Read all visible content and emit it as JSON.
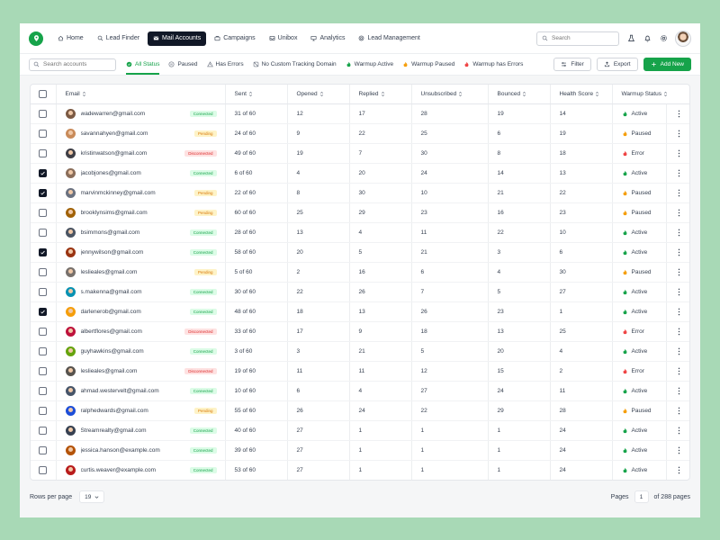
{
  "nav": {
    "items": [
      {
        "label": "Home",
        "icon": "home-icon"
      },
      {
        "label": "Lead Finder",
        "icon": "search-icon"
      },
      {
        "label": "Mail Accounts",
        "icon": "mail-icon",
        "active": true
      },
      {
        "label": "Campaigns",
        "icon": "briefcase-icon"
      },
      {
        "label": "Unibox",
        "icon": "inbox-icon"
      },
      {
        "label": "Analytics",
        "icon": "monitor-icon"
      },
      {
        "label": "Lead Management",
        "icon": "target-icon"
      }
    ],
    "search_placeholder": "Search"
  },
  "filters": {
    "search_placeholder": "Search accounts",
    "tabs": [
      {
        "label": "All Status",
        "icon": "check-circle-icon",
        "active": true
      },
      {
        "label": "Paused",
        "icon": "pause-circle-icon"
      },
      {
        "label": "Has Errors",
        "icon": "alert-icon"
      },
      {
        "label": "No Custom Tracking Domain",
        "icon": "globe-off-icon"
      },
      {
        "label": "Warmup Active",
        "icon": "flame-green-icon"
      },
      {
        "label": "Warmup Paused",
        "icon": "flame-orange-icon"
      },
      {
        "label": "Warmup has Errors",
        "icon": "flame-red-icon"
      }
    ],
    "filter_label": "Filter",
    "export_label": "Export",
    "add_label": "Add New"
  },
  "table": {
    "columns": [
      "Email",
      "Sent",
      "Opened",
      "Replied",
      "Unsubscribed",
      "Bounced",
      "Health Score",
      "Warmup Status"
    ],
    "rows": [
      {
        "email": "wadewarren@gmail.com",
        "conn": "Connected",
        "sent": "31 of 60",
        "opened": "12",
        "replied": "17",
        "unsub": "28",
        "bounced": "19",
        "health": "14",
        "warmup": "Active",
        "checked": false
      },
      {
        "email": "savannahyen@gmail.com",
        "conn": "Pending",
        "sent": "24 of 60",
        "opened": "9",
        "replied": "22",
        "unsub": "25",
        "bounced": "6",
        "health": "19",
        "warmup": "Paused",
        "checked": false
      },
      {
        "email": "kristinwatson@gmail.com",
        "conn": "Disconnected",
        "sent": "49 of 60",
        "opened": "19",
        "replied": "7",
        "unsub": "30",
        "bounced": "8",
        "health": "18",
        "warmup": "Error",
        "checked": false
      },
      {
        "email": "jacobjones@gmail.com",
        "conn": "Connected",
        "sent": "6 of 60",
        "opened": "4",
        "replied": "20",
        "unsub": "24",
        "bounced": "14",
        "health": "13",
        "warmup": "Active",
        "checked": true
      },
      {
        "email": "marvinmckinney@gmail.com",
        "conn": "Pending",
        "sent": "22 of 60",
        "opened": "8",
        "replied": "30",
        "unsub": "10",
        "bounced": "21",
        "health": "22",
        "warmup": "Paused",
        "checked": true
      },
      {
        "email": "brooklynsims@gmail.com",
        "conn": "Pending",
        "sent": "60 of 60",
        "opened": "25",
        "replied": "29",
        "unsub": "23",
        "bounced": "16",
        "health": "23",
        "warmup": "Paused",
        "checked": false
      },
      {
        "email": "bsimmons@gmail.com",
        "conn": "Connected",
        "sent": "28 of 60",
        "opened": "13",
        "replied": "4",
        "unsub": "11",
        "bounced": "22",
        "health": "10",
        "warmup": "Active",
        "checked": false
      },
      {
        "email": "jennywilson@gmail.com",
        "conn": "Connected",
        "sent": "58 of 60",
        "opened": "20",
        "replied": "5",
        "unsub": "21",
        "bounced": "3",
        "health": "6",
        "warmup": "Active",
        "checked": true
      },
      {
        "email": "leslieales@gmail.com",
        "conn": "Pending",
        "sent": "5 of 60",
        "opened": "2",
        "replied": "16",
        "unsub": "6",
        "bounced": "4",
        "health": "30",
        "warmup": "Paused",
        "checked": false
      },
      {
        "email": "s.makenna@gmail.com",
        "conn": "Connected",
        "sent": "30 of 60",
        "opened": "22",
        "replied": "26",
        "unsub": "7",
        "bounced": "5",
        "health": "27",
        "warmup": "Active",
        "checked": false
      },
      {
        "email": "darlenerob@gmail.com",
        "conn": "Connected",
        "sent": "48 of 60",
        "opened": "18",
        "replied": "13",
        "unsub": "26",
        "bounced": "23",
        "health": "1",
        "warmup": "Active",
        "checked": true
      },
      {
        "email": "albertflores@gmail.com",
        "conn": "Disconnected",
        "sent": "33 of 60",
        "opened": "17",
        "replied": "9",
        "unsub": "18",
        "bounced": "13",
        "health": "25",
        "warmup": "Error",
        "checked": false
      },
      {
        "email": "guyhawkins@gmail.com",
        "conn": "Connected",
        "sent": "3 of 60",
        "opened": "3",
        "replied": "21",
        "unsub": "5",
        "bounced": "20",
        "health": "4",
        "warmup": "Active",
        "checked": false
      },
      {
        "email": "leslieales@gmail.com",
        "conn": "Disconnected",
        "sent": "19 of 60",
        "opened": "11",
        "replied": "11",
        "unsub": "12",
        "bounced": "15",
        "health": "2",
        "warmup": "Error",
        "checked": false
      },
      {
        "email": "ahmad.westervelt@gmail.com",
        "conn": "Connected",
        "sent": "10 of 60",
        "opened": "6",
        "replied": "4",
        "unsub": "27",
        "bounced": "24",
        "health": "11",
        "warmup": "Active",
        "checked": false
      },
      {
        "email": "ralphedwards@gmail.com",
        "conn": "Pending",
        "sent": "55 of 60",
        "opened": "26",
        "replied": "24",
        "unsub": "22",
        "bounced": "29",
        "health": "28",
        "warmup": "Paused",
        "checked": false
      },
      {
        "email": "Streamrealty@gmail.com",
        "conn": "Connected",
        "sent": "40 of 60",
        "opened": "27",
        "replied": "1",
        "unsub": "1",
        "bounced": "1",
        "health": "24",
        "warmup": "Active",
        "checked": false
      },
      {
        "email": "jessica.hanson@example.com",
        "conn": "Connected",
        "sent": "39 of 60",
        "opened": "27",
        "replied": "1",
        "unsub": "1",
        "bounced": "1",
        "health": "24",
        "warmup": "Active",
        "checked": false
      },
      {
        "email": "curtis.weaver@example.com",
        "conn": "Connected",
        "sent": "53 of 60",
        "opened": "27",
        "replied": "1",
        "unsub": "1",
        "bounced": "1",
        "health": "24",
        "warmup": "Active",
        "checked": false
      }
    ]
  },
  "footer": {
    "rows_per_page_label": "Rows per page",
    "rows_per_page_value": "19",
    "pages_label": "Pages",
    "current_page": "1",
    "total_pages_label": "of 288 pages"
  },
  "colors": {
    "brand": "#16a34a",
    "active_nav": "#111827",
    "pending": "#d97706",
    "error": "#dc2626"
  }
}
